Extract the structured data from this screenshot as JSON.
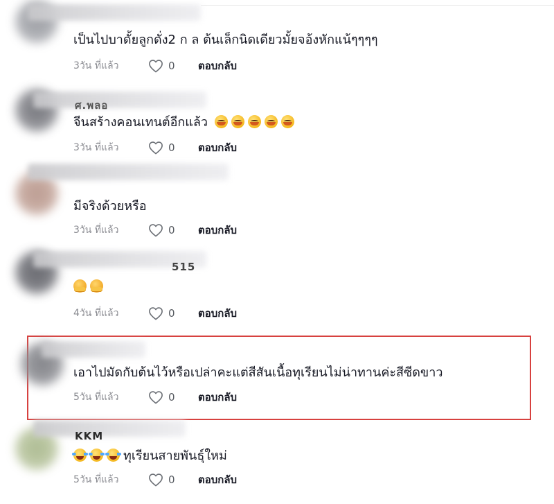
{
  "comments": [
    {
      "text": "เป็นไปบาดั้ยลูกดั่ง2 ก ล ต้นเล็กนิดเดียวมั้ยจอ้งหักแน้ๆๆๆๆ",
      "time": "3วัน ที่แล้ว",
      "likes": "0",
      "reply": "ตอบกลับ",
      "name_fragment": ""
    },
    {
      "text": "จีนสร้างคอนเทนต์อีกแล้ว",
      "emojis": [
        "blush-emoji",
        "blush-emoji",
        "blush-emoji",
        "blush-emoji",
        "blush-emoji"
      ],
      "time": "3วัน ที่แล้ว",
      "likes": "0",
      "reply": "ตอบกลับ",
      "name_fragment": "ศ.พลอ"
    },
    {
      "text": "มีจริงด้วยหรือ",
      "time": "3วัน ที่แล้ว",
      "likes": "0",
      "reply": "ตอบกลับ",
      "name_fragment": ""
    },
    {
      "text": "",
      "emojis": [
        "hugging-emoji",
        "hugging-emoji"
      ],
      "time": "4วัน ที่แล้ว",
      "likes": "0",
      "reply": "ตอบกลับ",
      "name_fragment": "515"
    },
    {
      "text": "เอาไปมัดกับต้นไว้หรือเปล่าคะแต่สีสันเนื้อทุเรียนไม่น่าทานค่ะสีซีดขาว",
      "time": "5วัน ที่แล้ว",
      "likes": "0",
      "reply": "ตอบกลับ",
      "name_fragment": "",
      "highlighted": true
    },
    {
      "text": "ทุเรียนสายพันธุ์ใหม่",
      "emojis": [
        "joy-emoji",
        "joy-emoji",
        "joy-emoji"
      ],
      "time": "5วัน ที่แล้ว",
      "likes": "0",
      "reply": "ตอบกลับ",
      "name_fragment": "KKM"
    }
  ],
  "colors": {
    "highlight_border": "#d7413f",
    "meta_text": "#8a8b91",
    "body_text": "#161823"
  }
}
